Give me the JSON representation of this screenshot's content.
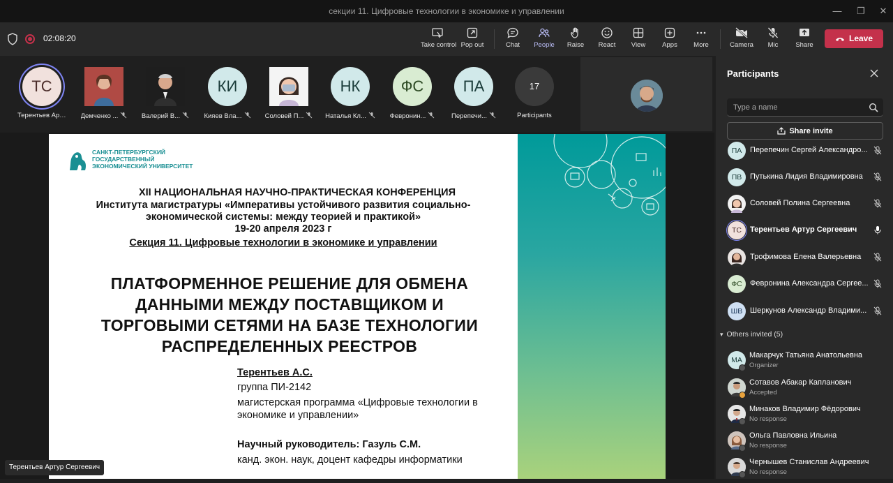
{
  "window": {
    "title": "секции 11. Цифровые технологии в экономике и управлении"
  },
  "toolbar": {
    "timer": "02:08:20",
    "buttons": {
      "take_control": "Take control",
      "pop_out": "Pop out",
      "chat": "Chat",
      "people": "People",
      "raise": "Raise",
      "react": "React",
      "view": "View",
      "apps": "Apps",
      "more": "More",
      "camera": "Camera",
      "mic": "Mic",
      "share": "Share"
    },
    "leave": "Leave",
    "colors": {
      "leave": "#c4314b",
      "active": "#7f85f5"
    }
  },
  "strip": {
    "tiles": [
      {
        "initials": "ТС",
        "name": "Терентьев Арт..."
      },
      {
        "initials": "",
        "name": "Демченко ..."
      },
      {
        "initials": "",
        "name": "Валерий В..."
      },
      {
        "initials": "КИ",
        "name": "Кияев Вла..."
      },
      {
        "initials": "",
        "name": "Соловей П..."
      },
      {
        "initials": "НК",
        "name": "Наталья Кл..."
      },
      {
        "initials": "ФС",
        "name": "Февронин..."
      },
      {
        "initials": "ПА",
        "name": "Перепечи..."
      }
    ],
    "count": {
      "value": "17",
      "label": "Participants"
    }
  },
  "slide": {
    "logo_lines": [
      "САНКТ-ПЕТЕРБУРГСКИЙ",
      "ГОСУДАРСТВЕННЫЙ",
      "ЭКОНОМИЧЕСКИЙ УНИВЕРСИТЕТ"
    ],
    "conf_line1": "XII НАЦИОНАЛЬНАЯ НАУЧНО-ПРАКТИЧЕСКАЯ КОНФЕРЕНЦИЯ",
    "conf_line2": "Института магистратуры «Императивы устойчивого развития социально-",
    "conf_line3": "экономической системы: между теорией и практикой»",
    "conf_date": "19-20 апреля 2023 г",
    "section": "Секция 11. Цифровые технологии в экономике и управлении",
    "title_lines": [
      "ПЛАТФОРМЕННОЕ РЕШЕНИЕ ДЛЯ ОБМЕНА",
      "ДАННЫМИ МЕЖДУ ПОСТАВЩИКОМ И",
      "ТОРГОВЫМИ СЕТЯМИ НА БАЗЕ ТЕХНОЛОГИИ",
      "РАСПРЕДЕЛЕННЫХ РЕЕСТРОВ"
    ],
    "author": "Терентьев А.С.",
    "group": "группа ПИ-2142",
    "program_line1": "магистерская программа «Цифровые технологии в",
    "program_line2": "экономике и управлении»",
    "supervisor": "Научный руководитель: Газуль С.М.",
    "supervisor_detail": "канд. экон. наук, доцент кафедры информатики"
  },
  "presenter_tag": "Терентьев Артур Сергеевич",
  "panel": {
    "title": "Participants",
    "search_placeholder": "Type a name",
    "share_invite": "Share invite",
    "participants": [
      {
        "initials": "ПА",
        "name": "Перепечин Сергей Александро...",
        "mic": "off"
      },
      {
        "initials": "ПВ",
        "name": "Путькина Лидия Владимировна",
        "mic": "off"
      },
      {
        "initials": "",
        "name": "Соловей Полина Сергеевна",
        "mic": "off"
      },
      {
        "initials": "ТС",
        "name": "Терентьев Артур Сергеевич",
        "mic": "on"
      },
      {
        "initials": "",
        "name": "Трофимова Елена Валерьевна",
        "mic": "off"
      },
      {
        "initials": "ФС",
        "name": "Февронина Александра Сергее...",
        "mic": "off"
      },
      {
        "initials": "ШВ",
        "name": "Шеркунов Александр Владими...",
        "mic": "off"
      }
    ],
    "others_label": "Others invited (5)",
    "invited": [
      {
        "initials": "МА",
        "name": "Макарчук Татьяна Анатольевна",
        "status": "Organizer"
      },
      {
        "initials": "",
        "name": "Сотавов Абакар Капланович",
        "status": "Accepted"
      },
      {
        "initials": "",
        "name": "Минаков Владимир Фёдорович",
        "status": "No response"
      },
      {
        "initials": "",
        "name": "Ольга Павловна Ильина",
        "status": "No response"
      },
      {
        "initials": "",
        "name": "Чернышев Станислав Андреевич",
        "status": "No response"
      }
    ]
  }
}
